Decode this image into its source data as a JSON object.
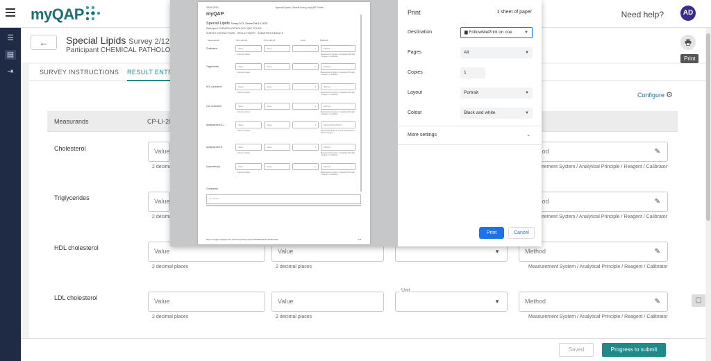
{
  "app": {
    "logo_text": "myQAP",
    "need_help": "Need help?",
    "avatar_initials": "AD",
    "brand_color": "#1e6e78",
    "accent_color": "#1e8a8a"
  },
  "header": {
    "back_icon": "←",
    "title": "Special Lipids",
    "title_sub": "Survey 2/12,  C",
    "participant": "Participant CHEMICAL PATHOLOGY",
    "print_tooltip": "Print"
  },
  "tabs": [
    {
      "label": "SURVEY INSTRUCTIONS"
    },
    {
      "label": "RESULT ENTRY"
    }
  ],
  "toolbar": {
    "configure": "Configure"
  },
  "table": {
    "col_measurands": "Measurands",
    "col_code": "CP-LI-20"
  },
  "rows": [
    {
      "label": "Cholesterol",
      "value_placeholder": "Value",
      "decimal_hint": "2 decimal",
      "method_placeholder": "thod",
      "method_hint": "asurement System / Analytical Principle / Reagent / Calibrator"
    },
    {
      "label": "Triglycerides",
      "value_placeholder": "Value",
      "decimal_hint": "2 decimal",
      "method_placeholder": "thod",
      "method_hint": "asurement System / Analytical Principle / Reagent / Calibrator"
    },
    {
      "label": "HDL cholesterol",
      "value_placeholder": "Value",
      "value2_placeholder": "Value",
      "decimal_hint": "2 decimal places",
      "decimal_hint2": "2 decimal places",
      "method_placeholder": "Method",
      "method_hint": "Measurement System / Analytical Principle / Reagent / Calibrator"
    },
    {
      "label": "LDL cholesterol",
      "value_placeholder": "Value",
      "value2_placeholder": "Value",
      "decimal_hint": "2 decimal places",
      "decimal_hint2": "2 decimal places",
      "unit_label": "Unit",
      "method_placeholder": "Method",
      "method_hint": "Measurement System / Analytical Principle / Reagent / Calibrator"
    }
  ],
  "footer": {
    "saved": "Saved",
    "submit": "Progress to submit"
  },
  "print_dialog": {
    "title": "Print",
    "sheets": "1 sheet of paper",
    "destination_label": "Destination",
    "destination_value": "FollowMePrint on coe",
    "pages_label": "Pages",
    "pages_value": "All",
    "copies_label": "Copies",
    "copies_value": "1",
    "layout_label": "Layout",
    "layout_value": "Portrait",
    "colour_label": "Colour",
    "colour_value": "Black and white",
    "more_settings": "More settings",
    "print_button": "Print",
    "cancel_button": "Cancel",
    "print_button_color": "#1a73e8"
  },
  "preview": {
    "date": "29/01/2020",
    "page_title": "Special Lipids | Result Entry | myQAP Portal",
    "logo": "myQAP",
    "title": "Special Lipids",
    "title_sub": "Survey 2/12,  Closes Feb 15, 2020",
    "participant": "Participant CHEMICAL PATHOLOGY QAP CP1000",
    "tabs": [
      "SURVEY INSTRUCTIONS",
      "RESULT ENTRY",
      "SUBMITTED RESULTS"
    ],
    "headers": [
      "Measurands",
      "CP-LI-20-02",
      "CP-LI-20-04",
      "Units",
      "Methods"
    ],
    "rows": [
      {
        "label": "Cholesterol",
        "value1": "Value",
        "value2": "Value",
        "method": "Method",
        "hint": "2 decimal places",
        "method_hint": "Measurement System / Analytical Principle / Reagent / Calibrator"
      },
      {
        "label": "Triglycerides",
        "value1": "Value",
        "value2": "Value",
        "method": "Method",
        "hint": "2 decimal places",
        "method_hint": "Measurement System / Analytical Principle / Reagent / Calibrator"
      },
      {
        "label": "HDL cholesterol",
        "value1": "Value",
        "value2": "Value",
        "method": "Method",
        "hint": "2 decimal places",
        "method_hint": "Measurement System / Analytical Principle / Reagent / Calibrator"
      },
      {
        "label": "LDL cholesterol",
        "value1": "Value",
        "value2": "Value",
        "method": "Method",
        "hint": "2 decimal places",
        "method_hint": "Measurement System / Analytical Principle / Reagent / Calibrator"
      },
      {
        "label": "Apolipoprotein A-1",
        "value1": "Value",
        "value2": "Value",
        "method": "Abbott ARCHITECT...",
        "hint": "2 decimal places",
        "method_hint": "Abbott ARCHITECT / Immunoturbidimetric / Abbott reagent"
      },
      {
        "label": "Apolipoprotein B",
        "value1": "Value",
        "value2": "Value",
        "method": "Method",
        "hint": "2 decimal places",
        "method_hint": "Measurement System / Analytical Principle / Reagent / Calibrator"
      },
      {
        "label": "Lipoprotein(a)",
        "value1": "Value",
        "value2": "Value",
        "method": "Method",
        "hint": "2 decimal places",
        "method_hint": "Measurement System / Analytical Principle / Reagent / Calibrator"
      }
    ],
    "comments_label": "Comments",
    "comments_placeholder": "Comments",
    "url": "https://myqap.rcpaqap.com.au/surveys/surveyhome/2/2020/1317/1470/results",
    "page_num": "1/2"
  }
}
